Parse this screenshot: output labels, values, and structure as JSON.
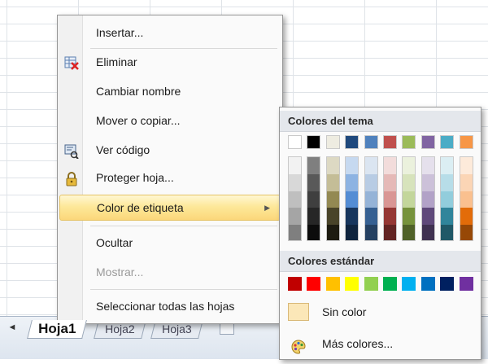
{
  "context_menu": {
    "items": [
      {
        "label": "Insertar...",
        "icon": "",
        "disabled": false
      },
      {
        "label": "Eliminar",
        "icon": "delete-sheet-icon",
        "disabled": false
      },
      {
        "label": "Cambiar nombre",
        "icon": "",
        "disabled": false
      },
      {
        "label": "Mover o copiar...",
        "icon": "",
        "disabled": false
      },
      {
        "label": "Ver código",
        "icon": "view-code-icon",
        "disabled": false
      },
      {
        "label": "Proteger hoja...",
        "icon": "lock-icon",
        "disabled": false
      },
      {
        "label": "Color de etiqueta",
        "icon": "",
        "disabled": false,
        "highlighted": true,
        "submenu": true
      },
      {
        "label": "Ocultar",
        "icon": "",
        "disabled": false
      },
      {
        "label": "Mostrar...",
        "icon": "",
        "disabled": true
      },
      {
        "label": "Seleccionar todas las hojas",
        "icon": "",
        "disabled": false
      }
    ]
  },
  "color_submenu": {
    "theme_header": "Colores del tema",
    "theme_colors": [
      "#ffffff",
      "#000000",
      "#eeece1",
      "#1f497d",
      "#4f81bd",
      "#c0504d",
      "#9bbb59",
      "#8064a2",
      "#4bacc6",
      "#f79646"
    ],
    "theme_shades": [
      [
        "#f2f2f2",
        "#d8d8d8",
        "#bfbfbf",
        "#a5a5a5",
        "#7f7f7f"
      ],
      [
        "#7f7f7f",
        "#595959",
        "#3f3f3f",
        "#262626",
        "#0c0c0c"
      ],
      [
        "#ddd9c3",
        "#c4bd97",
        "#938953",
        "#494429",
        "#1d1b10"
      ],
      [
        "#c6d9f0",
        "#8db3e2",
        "#548dd4",
        "#17365d",
        "#0f243e"
      ],
      [
        "#dbe5f1",
        "#b8cce4",
        "#95b3d7",
        "#366092",
        "#244061"
      ],
      [
        "#f2dcdb",
        "#e5b9b7",
        "#d99694",
        "#953734",
        "#632423"
      ],
      [
        "#ebf1dd",
        "#d7e3bc",
        "#c3d69b",
        "#76923c",
        "#4f6128"
      ],
      [
        "#e5e0ec",
        "#ccc1d9",
        "#b2a2c7",
        "#5f497a",
        "#3f3151"
      ],
      [
        "#dbeef3",
        "#b7dde8",
        "#92cddc",
        "#31859b",
        "#205867"
      ],
      [
        "#fdeada",
        "#fbd5b5",
        "#fac08f",
        "#e36c09",
        "#974806"
      ]
    ],
    "standard_header": "Colores estándar",
    "standard_colors": [
      "#c00000",
      "#ff0000",
      "#ffc000",
      "#ffff00",
      "#92d050",
      "#00b050",
      "#00b0f0",
      "#0070c0",
      "#002060",
      "#7030a0"
    ],
    "no_color_label": "Sin color",
    "more_colors_label": "Más colores..."
  },
  "sheet_tabs": {
    "nav_arrow": "◄",
    "tabs": [
      "Hoja1",
      "Hoja2",
      "Hoja3"
    ]
  }
}
